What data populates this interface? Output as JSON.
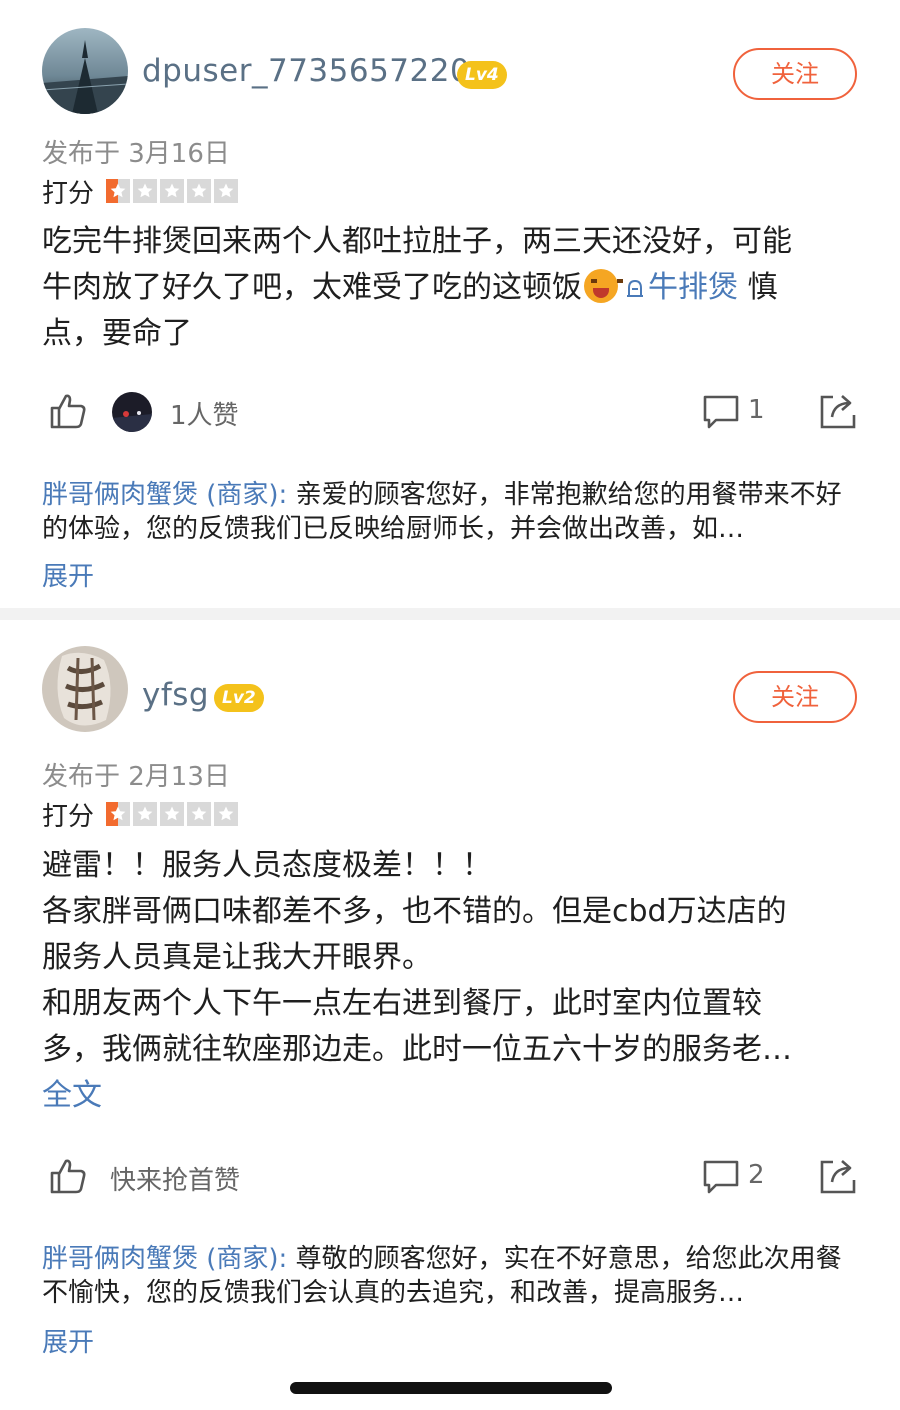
{
  "reviews": [
    {
      "username": "dpuser_7735657220",
      "level": "Lv4",
      "follow_label": "关注",
      "date": "发布于 3月16日",
      "rating_label": "打分",
      "rating": 0.5,
      "content": {
        "line1": "吃完牛排煲回来两个人都吐拉肚子，两三天还没好，可能",
        "line2_text": "牛肉放了好久了吧，太难受了吃的这顿饭",
        "tag": "牛排煲",
        "line2_after": " 慎",
        "line3": "点，要命了"
      },
      "likes_text": "1人赞",
      "comment_count": "1",
      "reply": {
        "merchant": "胖哥俩肉蟹煲 (商家):",
        "text": " 亲爱的顾客您好，非常抱歉给您的用餐带来不好的体验，您的反馈我们已反映给厨师长，并会做出改善，如…"
      },
      "expand_label": "展开"
    },
    {
      "username": "yfsg",
      "level": "Lv2",
      "follow_label": "关注",
      "date": "发布于 2月13日",
      "rating_label": "打分",
      "rating": 0.5,
      "content": {
        "line1": "避雷！！服务人员态度极差！！！",
        "line2": "各家胖哥俩口味都差不多，也不错的。但是cbd万达店的",
        "line3": "服务人员真是让我大开眼界。",
        "line4": "和朋友两个人下午一点左右进到餐厅，此时室内位置较",
        "line5": "多，我俩就往软座那边走。此时一位五六十岁的服务老…",
        "fulltext": "全文"
      },
      "likes_text": "快来抢首赞",
      "comment_count": "2",
      "reply": {
        "merchant": "胖哥俩肉蟹煲 (商家):",
        "text": " 尊敬的顾客您好，实在不好意思，给您此次用餐不愉快，您的反馈我们会认真的去追究，和改善，提高服务…"
      },
      "expand_label": "展开"
    }
  ],
  "colors": {
    "accent": "#f0623c",
    "link": "#4a7ab8",
    "username": "#5a7085",
    "level_badge": "#f4c21b",
    "star_fill": "#f26b2f"
  },
  "icons": {
    "like": "thumbs-up-icon",
    "comment": "comment-icon",
    "share": "share-icon",
    "tag": "tag-icon"
  }
}
